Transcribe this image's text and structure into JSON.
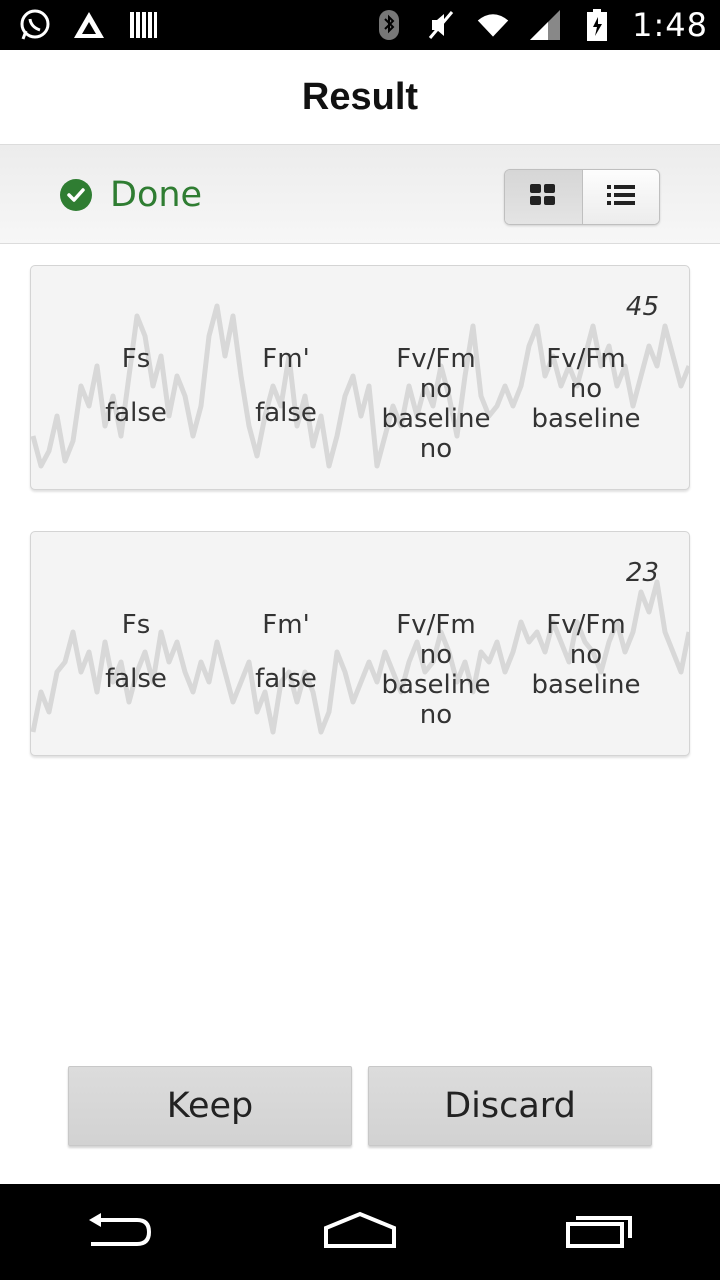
{
  "status_bar": {
    "time": "1:48",
    "left_icons": [
      "whatsapp-icon",
      "triangle-app-icon",
      "barcode-icon"
    ],
    "right_icons": [
      "bluetooth-icon",
      "muted-icon",
      "wifi-icon",
      "signal-icon",
      "battery-icon"
    ]
  },
  "header": {
    "title": "Result"
  },
  "subheader": {
    "status_label": "Done",
    "status_color": "#2f7d32",
    "view_modes": [
      "grid-view",
      "list-view"
    ],
    "active_view": "grid-view"
  },
  "cards": [
    {
      "count": "45",
      "columns": [
        {
          "label": "Fs",
          "value": "false"
        },
        {
          "label": "Fm'",
          "value": "false"
        },
        {
          "label": "Fv/Fm\nno\nbaseline\nno",
          "value": ""
        },
        {
          "label": "Fv/Fm\nno\nbaseline",
          "value": ""
        }
      ]
    },
    {
      "count": "23",
      "columns": [
        {
          "label": "Fs",
          "value": "false"
        },
        {
          "label": "Fm'",
          "value": "false"
        },
        {
          "label": "Fv/Fm\nno\nbaseline\nno",
          "value": ""
        },
        {
          "label": "Fv/Fm\nno\nbaseline",
          "value": ""
        }
      ]
    }
  ],
  "actions": {
    "keep_label": "Keep",
    "discard_label": "Discard"
  },
  "nav_bar": {
    "icons": [
      "back-icon",
      "home-icon",
      "recents-icon"
    ]
  }
}
